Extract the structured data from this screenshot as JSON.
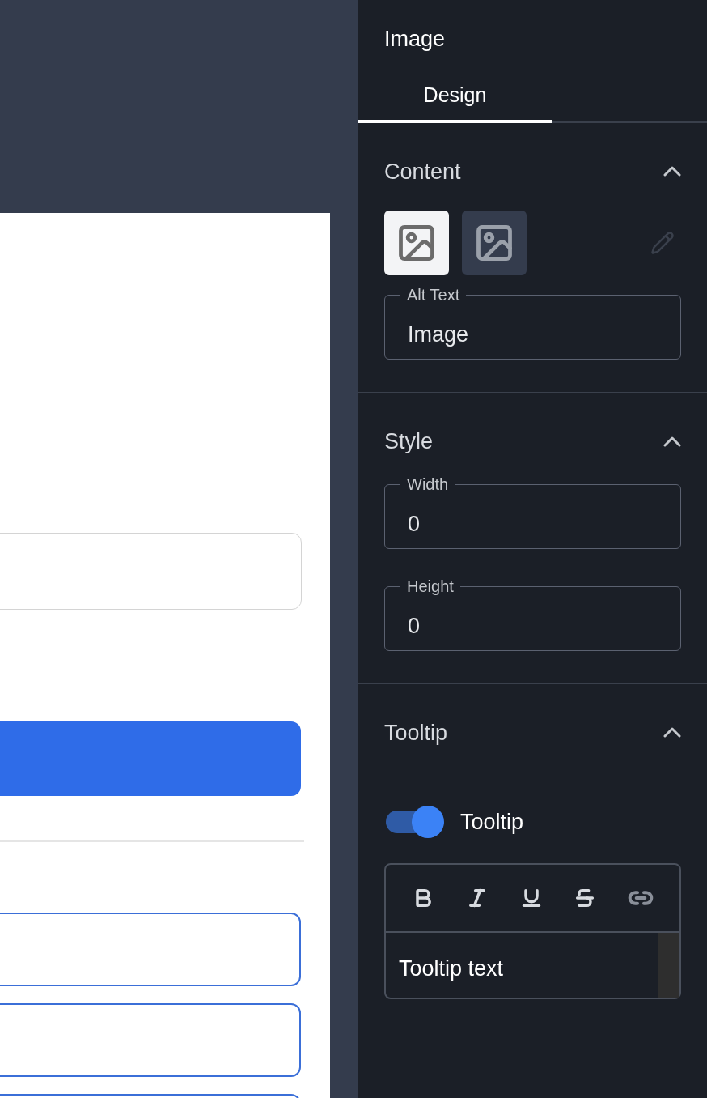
{
  "panel": {
    "title": "Image"
  },
  "tabs": [
    {
      "label": "Design",
      "selected": true
    }
  ],
  "content": {
    "heading": "Content",
    "expanded": true,
    "image_options": [
      {
        "selected": true
      },
      {
        "selected": false
      }
    ],
    "edit_disabled": true,
    "alt_text": {
      "label": "Alt Text",
      "value": "Image"
    }
  },
  "style": {
    "heading": "Style",
    "expanded": true,
    "fields": [
      {
        "label": "Width",
        "value": "0"
      },
      {
        "label": "Height",
        "value": "0"
      }
    ]
  },
  "tooltip": {
    "heading": "Tooltip",
    "expanded": true,
    "toggle_label": "Tooltip",
    "on": true,
    "editor_text": "Tooltip text"
  }
}
